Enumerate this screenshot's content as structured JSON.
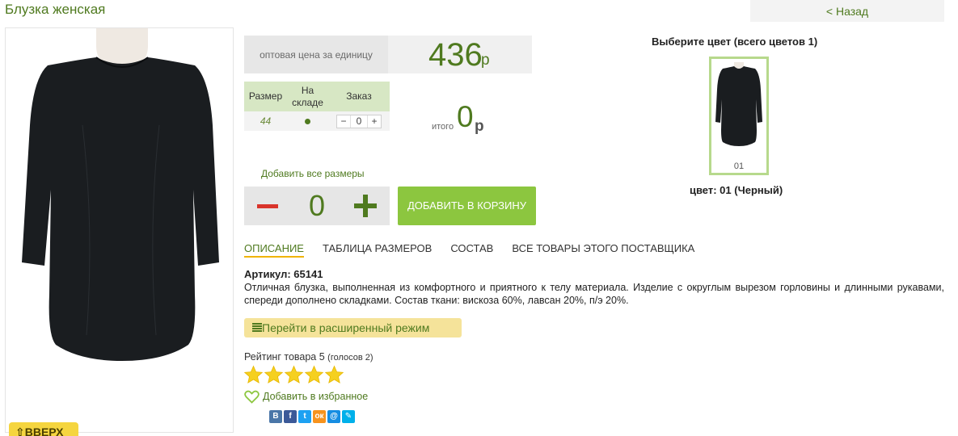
{
  "product": {
    "title": "Блузка женская",
    "back_label": "< Назад",
    "top_button_label": "⇧ВВЕРХ"
  },
  "price": {
    "label": "оптовая цена за единицу",
    "value": "436",
    "currency": "р"
  },
  "size_table": {
    "headers": [
      "Размер",
      "На складе",
      "Заказ"
    ],
    "rows": [
      {
        "size": "44",
        "in_stock": "●",
        "qty": "0",
        "minus": "−",
        "plus": "+"
      }
    ]
  },
  "total": {
    "label": "итого",
    "value": "0",
    "currency": "р"
  },
  "add_all": {
    "label": "Добавить все размеры",
    "value": "0",
    "cart_button": "ДОБАВИТЬ В КОРЗИНУ"
  },
  "tabs": [
    "ОПИСАНИЕ",
    "ТАБЛИЦА РАЗМЕРОВ",
    "СОСТАВ",
    "ВСЕ ТОВАРЫ ЭТОГО ПОСТАВЩИКА"
  ],
  "description": {
    "article": "Артикул: 65141",
    "text": "Отличная блузка, выполненная из комфортного и приятного к телу материала. Изделие с округлым вырезом горловины и длинными рукавами, спереди дополнено складками. Состав ткани: вискоза 60%, лавсан 20%, п/э 20%."
  },
  "mode_button": "Перейти в расширенный режим",
  "rating": {
    "label": "Рейтинг товара 5",
    "votes": "(голосов 2)",
    "value": 5,
    "max": 5
  },
  "favorite_label": "Добавить в избранное",
  "social": [
    {
      "icon": "vkontakte-icon",
      "glyph": "В",
      "color": "#4a76a8"
    },
    {
      "icon": "facebook-icon",
      "glyph": "f",
      "color": "#3b5998"
    },
    {
      "icon": "twitter-icon",
      "glyph": "t",
      "color": "#1da1f2"
    },
    {
      "icon": "odnoklassniki-icon",
      "glyph": "ок",
      "color": "#f7931e"
    },
    {
      "icon": "mailru-icon",
      "glyph": "@",
      "color": "#168de2"
    },
    {
      "icon": "livejournal-icon",
      "glyph": "✎",
      "color": "#00b0ea"
    }
  ],
  "colors": {
    "heading": "Выберите цвет (всего цветов 1)",
    "swatch_label": "01",
    "selected_caption": "цвет: 01 (Черный)"
  },
  "palette": {
    "accent_green": "#4f7a1f",
    "button_green": "#8cc63f",
    "header_green": "#d7e7c4",
    "star_yellow": "#f5d020"
  }
}
